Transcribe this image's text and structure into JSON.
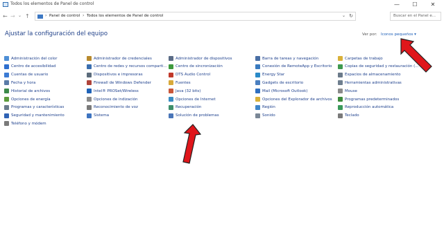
{
  "window": {
    "title": "Todos los elementos de Panel de control"
  },
  "controls": {
    "minimize": "—",
    "maximize": "☐",
    "close": "✕"
  },
  "nav": {
    "back": "←",
    "forward": "→",
    "dropdown": "⌄",
    "up": "↑"
  },
  "address": {
    "crumbs": [
      "Panel de control",
      "Todos los elementos de Panel de control"
    ],
    "separator": "›",
    "dropdown": "⌄",
    "refresh": "↻"
  },
  "search": {
    "placeholder": "Buscar en el Panel e..."
  },
  "page": {
    "title": "Ajustar la configuración del equipo"
  },
  "view": {
    "label": "Ver por:",
    "value": "Iconos pequeños ▾"
  },
  "columns": [
    [
      {
        "label": "Administración del color",
        "color": "#4f8fd6"
      },
      {
        "label": "Centro de accesibilidad",
        "color": "#2e6fcf"
      },
      {
        "label": "Cuentas de usuario",
        "color": "#3b7bd4"
      },
      {
        "label": "Fecha y hora",
        "color": "#5a7ba8"
      },
      {
        "label": "Historial de archivos",
        "color": "#3c8a4a"
      },
      {
        "label": "Opciones de energía",
        "color": "#5c9c3c"
      },
      {
        "label": "Programas y características",
        "color": "#6a7c8c"
      },
      {
        "label": "Seguridad y mantenimiento",
        "color": "#2f63b5"
      },
      {
        "label": "Teléfono y módem",
        "color": "#7a7a7a"
      }
    ],
    [
      {
        "label": "Administrador de credenciales",
        "color": "#b88a2e"
      },
      {
        "label": "Centro de redes y recursos comparti...",
        "color": "#3a6fb0"
      },
      {
        "label": "Dispositivos e impresoras",
        "color": "#5b6b7b"
      },
      {
        "label": "Firewall de Windows Defender",
        "color": "#b0433a"
      },
      {
        "label": "Intel® PROSet/Wireless",
        "color": "#1f63b8"
      },
      {
        "label": "Opciones de indización",
        "color": "#8a8a8a"
      },
      {
        "label": "Reconocimiento de voz",
        "color": "#7a7a7a"
      },
      {
        "label": "Sistema",
        "color": "#3e74c0"
      }
    ],
    [
      {
        "label": "Administrador de dispositivos",
        "color": "#5b6c86"
      },
      {
        "label": "Centro de sincronización",
        "color": "#3e9a3e"
      },
      {
        "label": "DTS Audio Control",
        "color": "#c0392b"
      },
      {
        "label": "Fuentes",
        "color": "#d8a93a"
      },
      {
        "label": "Java (32 bits)",
        "color": "#c9573a"
      },
      {
        "label": "Opciones de Internet",
        "color": "#3a8dc4"
      },
      {
        "label": "Recuperación",
        "color": "#3e8f6a"
      },
      {
        "label": "Solución de problemas",
        "color": "#4a76b8"
      }
    ],
    [
      {
        "label": "Barra de tareas y navegación",
        "color": "#4a6fa5"
      },
      {
        "label": "Conexión de RemoteApp y Escritorio",
        "color": "#3a7abf"
      },
      {
        "label": "Energy Star",
        "color": "#2a8ac8"
      },
      {
        "label": "Gadgets de escritorio",
        "color": "#4a7fc0"
      },
      {
        "label": "Mail (Microsoft Outlook)",
        "color": "#2f6fc0"
      },
      {
        "label": "Opciones del Explorador de archivos",
        "color": "#d9b13a"
      },
      {
        "label": "Región",
        "color": "#3f86c9"
      },
      {
        "label": "Sonido",
        "color": "#7a8796"
      }
    ],
    [
      {
        "label": "Carpetas de trabajo",
        "color": "#d9b13a"
      },
      {
        "label": "Copias de seguridad y restauración (...",
        "color": "#3f9a4f"
      },
      {
        "label": "Espacios de almacenamiento",
        "color": "#6b7a8a"
      },
      {
        "label": "Herramientas administrativas",
        "color": "#6f7f8f"
      },
      {
        "label": "Mouse",
        "color": "#8a8a8a"
      },
      {
        "label": "Programas predeterminados",
        "color": "#3c8a3c"
      },
      {
        "label": "Reproducción automática",
        "color": "#3b9a5a"
      },
      {
        "label": "Teclado",
        "color": "#7a7a7a"
      }
    ]
  ]
}
